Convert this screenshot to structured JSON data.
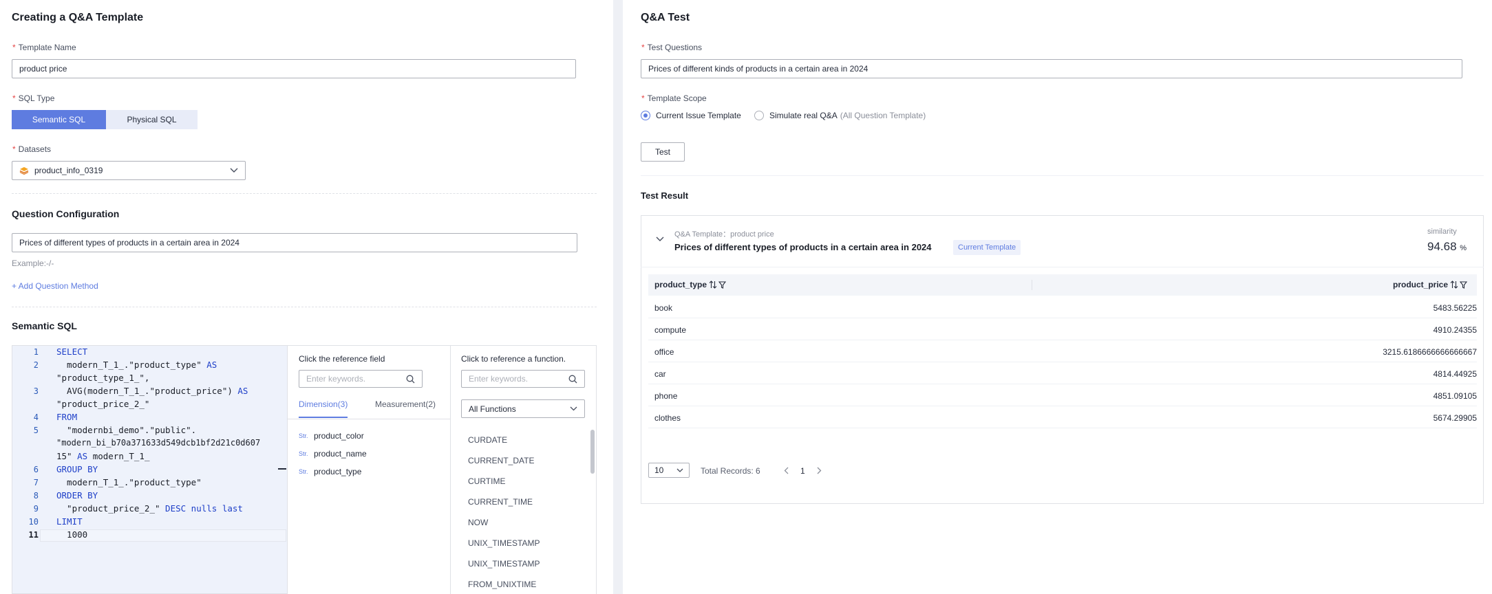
{
  "left": {
    "title": "Creating a Q&A Template",
    "template_name_label": "Template Name",
    "template_name_value": "product price",
    "sql_type_label": "SQL Type",
    "sql_type_options": [
      "Semantic SQL",
      "Physical SQL"
    ],
    "datasets_label": "Datasets",
    "dataset_value": "product_info_0319",
    "question_config_title": "Question Configuration",
    "question_value": "Prices of different types of products in a certain area in 2024",
    "example_text": "Example:-/-",
    "add_question_method": "+ Add Question Method",
    "semantic_sql_title": "Semantic SQL",
    "code_lines": [
      {
        "n": "1",
        "html_key": "l1"
      },
      {
        "n": "2"
      },
      {
        "n": "3"
      },
      {
        "n": "4"
      },
      {
        "n": "5"
      },
      {
        "n": "6"
      },
      {
        "n": "7"
      },
      {
        "n": "8"
      },
      {
        "n": "9"
      },
      {
        "n": "10"
      },
      {
        "n": "11"
      }
    ],
    "code": {
      "l1": "SELECT",
      "l2a": "  modern_T_1_.\"product_type\" ",
      "l2b": "AS",
      "l2c": "\"product_type_1_\",",
      "l3a": "  AVG(modern_T_1_.\"product_price\") ",
      "l3b": "AS",
      "l3c": "\"product_price_2_\"",
      "l4": "FROM",
      "l5a": "  \"modernbi_demo\".\"public\".",
      "l5b": "\"modern_bi_b70a371633d549dcb1bf2d21c0d607",
      "l5c": "15\" ",
      "l5d": "AS",
      "l5e": " modern_T_1_",
      "l6": "GROUP BY",
      "l7": "  modern_T_1_.\"product_type\"",
      "l8": "ORDER BY",
      "l9a": "  \"product_price_2_\" ",
      "l9b": "DESC nulls last",
      "l10": "LIMIT",
      "l11": "  1000"
    },
    "ref_field": {
      "title": "Click the reference field",
      "search_placeholder": "Enter keywords.",
      "tabs": [
        "Dimension(3)",
        "Measurement(2)"
      ],
      "type_tag": "Str.",
      "fields": [
        "product_color",
        "product_name",
        "product_type"
      ]
    },
    "ref_func": {
      "title": "Click to reference a function.",
      "search_placeholder": "Enter keywords.",
      "category": "All Functions",
      "functions": [
        "CURDATE",
        "CURRENT_DATE",
        "CURTIME",
        "CURRENT_TIME",
        "NOW",
        "UNIX_TIMESTAMP",
        "UNIX_TIMESTAMP",
        "FROM_UNIXTIME"
      ]
    }
  },
  "right": {
    "title": "Q&A Test",
    "test_questions_label": "Test Questions",
    "test_question_value": "Prices of different kinds of products in a certain area in 2024",
    "template_scope_label": "Template Scope",
    "scope_current": "Current Issue Template",
    "scope_simulate": "Simulate real Q&A",
    "scope_simulate_note": "(All Question Template)",
    "test_button": "Test",
    "result_title": "Test Result",
    "card": {
      "template_line": "Q&A Template：product price",
      "question": "Prices of different types of products in a certain area in 2024",
      "badge": "Current Template",
      "similarity_label": "similarity",
      "similarity_value": "94.68",
      "similarity_unit": "%"
    },
    "table": {
      "columns": [
        "product_type",
        "product_price"
      ],
      "rows": [
        [
          "book",
          "5483.56225"
        ],
        [
          "compute",
          "4910.24355"
        ],
        [
          "office",
          "3215.6186666666666667"
        ],
        [
          "car",
          "4814.44925"
        ],
        [
          "phone",
          "4851.09105"
        ],
        [
          "clothes",
          "5674.29905"
        ]
      ]
    },
    "pagination": {
      "page_size": "10",
      "total": "Total Records: 6",
      "page": "1"
    }
  },
  "colors": {
    "primary": "#5e7ce0",
    "required": "#e54545",
    "segment_inactive": "#e8ecf8"
  }
}
